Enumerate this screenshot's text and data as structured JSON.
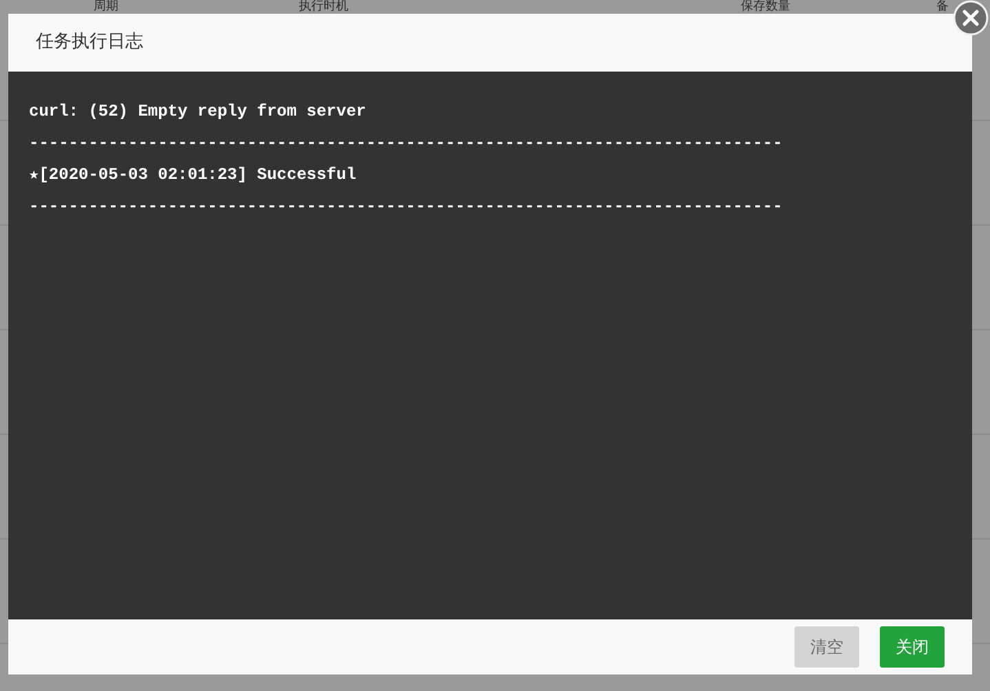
{
  "background_table": {
    "columns": [
      "周期",
      "执行时机",
      "保存数量",
      "备"
    ]
  },
  "dialog": {
    "title": "任务执行日志",
    "log_lines": [
      "curl: (52) Empty reply from server",
      "----------------------------------------------------------------------------",
      "★[2020-05-03 02:01:23] Successful",
      "----------------------------------------------------------------------------"
    ],
    "buttons": [
      {
        "label": "清空",
        "kind": "secondary",
        "disabled": true
      },
      {
        "label": "关闭",
        "kind": "primary",
        "disabled": false
      }
    ]
  }
}
